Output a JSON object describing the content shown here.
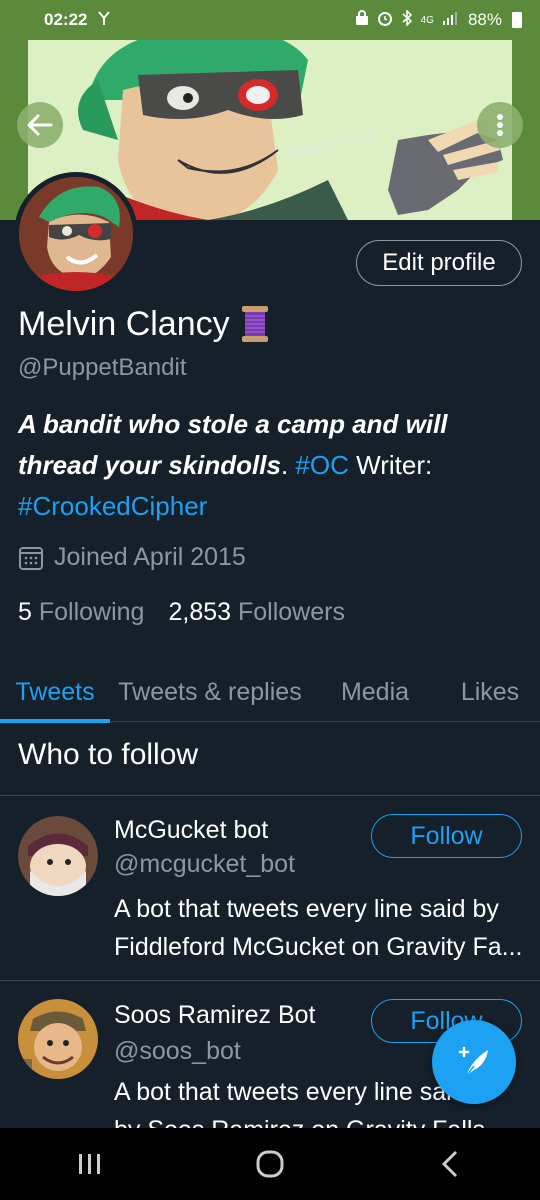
{
  "status_bar": {
    "time": "02:22",
    "battery": "88%",
    "signal_label": "4G"
  },
  "banner": {
    "signature": "MEDLEY 2020"
  },
  "profile": {
    "edit_label": "Edit profile",
    "display_name": "Melvin Clancy",
    "handle": "@PuppetBandit",
    "bio_bold": "A bandit who stole a camp and will thread your skindolls",
    "bio_period": ".",
    "bio_tag1": "#OC",
    "bio_writer": "Writer:",
    "bio_tag2": "#CrookedCipher",
    "joined": "Joined April 2015",
    "following_count": "5",
    "following_label": "Following",
    "followers_count": "2,853",
    "followers_label": "Followers"
  },
  "tabs": [
    {
      "label": "Tweets",
      "active": true
    },
    {
      "label": "Tweets & replies",
      "active": false
    },
    {
      "label": "Media",
      "active": false
    },
    {
      "label": "Likes",
      "active": false
    }
  ],
  "who_to_follow": {
    "title": "Who to follow",
    "items": [
      {
        "name": "McGucket bot",
        "handle": "@mcgucket_bot",
        "follow_label": "Follow",
        "desc_line1": "A bot that tweets every line said by",
        "desc_line2": "Fiddleford McGucket on Gravity Fa..."
      },
      {
        "name": "Soos Ramirez Bot",
        "handle": "@soos_bot",
        "follow_label": "Follow",
        "desc_line1": "A bot that tweets every line said",
        "desc_line2": "by Soos Ramirez on Gravity Falls. T..."
      }
    ]
  },
  "colors": {
    "background": "#15202b",
    "accent": "#1da1f2",
    "secondary_text": "#8899a6",
    "status_bar": "#5a8a3a"
  }
}
